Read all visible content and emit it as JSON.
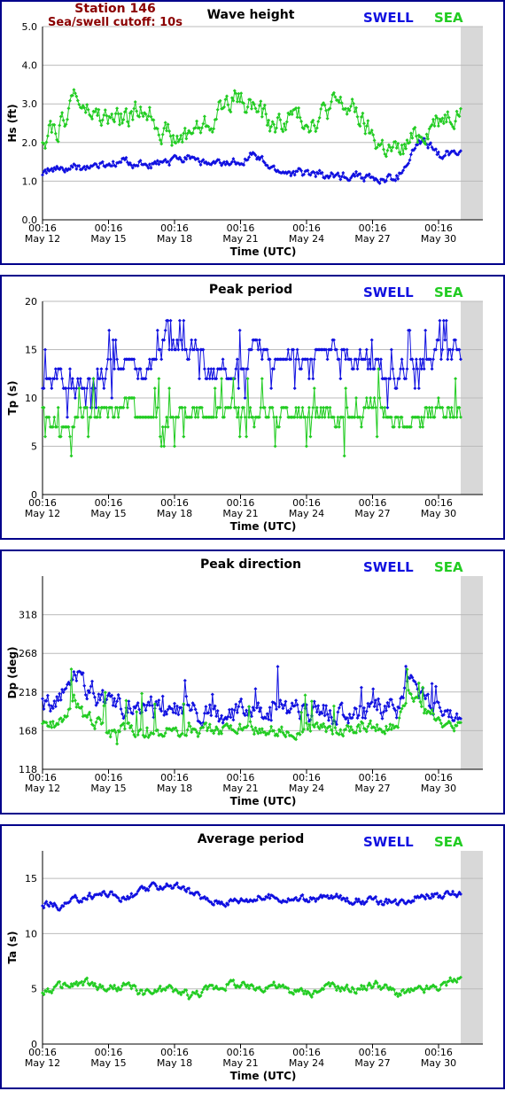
{
  "header": {
    "station": "Station 146",
    "cutoff": "Sea/swell cutoff: 10s"
  },
  "colors": {
    "swell": "#1010e0",
    "sea": "#22cc22",
    "frame": "#00008b",
    "grid": "#bbbbbb",
    "shade": "#d8d8d8"
  },
  "chart_data": [
    {
      "type": "scatter",
      "title": "Wave height",
      "ylabel": "Hs (ft)",
      "xlabel": "Time (UTC)",
      "ylim": [
        0,
        5
      ],
      "yticks": [
        "0.0",
        "1.0",
        "2.0",
        "3.0",
        "4.0",
        "5.0"
      ],
      "xlim": [
        0,
        20
      ],
      "xticks": [
        {
          "time": "00:16",
          "date": "May 12"
        },
        {
          "time": "00:16",
          "date": "May 15"
        },
        {
          "time": "00:16",
          "date": "May 18"
        },
        {
          "time": "00:16",
          "date": "May 21"
        },
        {
          "time": "00:16",
          "date": "May 24"
        },
        {
          "time": "00:16",
          "date": "May 27"
        },
        {
          "time": "00:16",
          "date": "May 30"
        }
      ],
      "grid": true,
      "legend": [
        "SWELL",
        "SEA"
      ],
      "series": [
        {
          "name": "SWELL",
          "color": "#1010e0",
          "x": [
            0,
            1,
            2,
            3,
            4,
            5,
            6,
            7,
            8,
            9,
            10,
            11,
            12,
            13,
            14,
            15,
            16,
            17,
            18,
            18.5,
            19,
            20
          ],
          "y": [
            1.25,
            1.3,
            1.35,
            1.4,
            1.5,
            1.4,
            1.45,
            1.7,
            1.4,
            1.45,
            1.7,
            1.3,
            1.2,
            1.2,
            1.1,
            1.2,
            1.0,
            1.1,
            2.0,
            1.9,
            1.7,
            1.8
          ]
        },
        {
          "name": "SEA",
          "color": "#22cc22",
          "x": [
            0,
            1,
            1.5,
            2,
            3,
            4,
            5,
            6,
            6.5,
            7,
            8,
            9,
            10,
            11,
            12,
            13,
            14,
            15,
            15.5,
            16,
            17,
            18,
            19,
            20
          ],
          "y": [
            2.2,
            2.5,
            3.3,
            2.8,
            2.6,
            2.6,
            2.9,
            2.2,
            2.0,
            2.3,
            2.5,
            3.2,
            3.0,
            2.4,
            2.7,
            2.6,
            3.0,
            2.8,
            2.3,
            2.0,
            1.7,
            2.2,
            2.7,
            2.9
          ]
        }
      ]
    },
    {
      "type": "scatter",
      "title": "Peak period",
      "ylabel": "Tp (s)",
      "xlabel": "Time (UTC)",
      "ylim": [
        0,
        20
      ],
      "yticks": [
        "0",
        "5",
        "10",
        "15",
        "20"
      ],
      "xlim": [
        0,
        20
      ],
      "xticks": [
        {
          "time": "00:16",
          "date": "May 12"
        },
        {
          "time": "00:16",
          "date": "May 15"
        },
        {
          "time": "00:16",
          "date": "May 18"
        },
        {
          "time": "00:16",
          "date": "May 21"
        },
        {
          "time": "00:16",
          "date": "May 24"
        },
        {
          "time": "00:16",
          "date": "May 27"
        },
        {
          "time": "00:16",
          "date": "May 30"
        }
      ],
      "grid": true,
      "legend": [
        "SWELL",
        "SEA"
      ],
      "series": [
        {
          "name": "SWELL",
          "color": "#1010e0",
          "x": [
            0,
            1,
            2,
            3,
            4,
            5,
            6,
            7,
            8,
            9,
            10,
            11,
            12,
            13,
            14,
            15,
            16,
            17,
            18,
            19,
            20
          ],
          "y": [
            12,
            12,
            11,
            13,
            14,
            13,
            16.5,
            15,
            13,
            12,
            15,
            14,
            14,
            14,
            15,
            14,
            13,
            12,
            14,
            15,
            15
          ]
        },
        {
          "name": "SEA",
          "color": "#22cc22",
          "x": [
            0,
            1,
            2,
            3,
            4,
            5,
            6,
            7,
            8,
            9,
            10,
            11,
            12,
            13,
            14,
            15,
            16,
            17,
            18,
            19,
            20
          ],
          "y": [
            8.5,
            7,
            9,
            9,
            9,
            8,
            7.5,
            9,
            8,
            9,
            8.5,
            8,
            9,
            8.5,
            8,
            8.5,
            9,
            7,
            7.5,
            8.5,
            8.5
          ]
        }
      ]
    },
    {
      "type": "scatter",
      "title": "Peak direction",
      "ylabel": "Dp (deg)",
      "xlabel": "Time (UTC)",
      "ylim": [
        118,
        368
      ],
      "yticks": [
        "118",
        "168",
        "218",
        "268",
        "318"
      ],
      "xlim": [
        0,
        20
      ],
      "xticks": [
        {
          "time": "00:16",
          "date": "May 12"
        },
        {
          "time": "00:16",
          "date": "May 15"
        },
        {
          "time": "00:16",
          "date": "May 18"
        },
        {
          "time": "00:16",
          "date": "May 21"
        },
        {
          "time": "00:16",
          "date": "May 24"
        },
        {
          "time": "00:16",
          "date": "May 27"
        },
        {
          "time": "00:16",
          "date": "May 30"
        }
      ],
      "grid": true,
      "legend": [
        "SWELL",
        "SEA"
      ],
      "series": [
        {
          "name": "SWELL",
          "color": "#1010e0",
          "x": [
            0,
            1,
            1.5,
            2,
            3,
            4,
            5,
            6,
            7,
            8,
            9,
            10,
            11,
            12,
            13,
            14,
            15,
            16,
            17,
            17.5,
            18,
            19,
            20
          ],
          "y": [
            200,
            215,
            250,
            225,
            205,
            200,
            210,
            200,
            195,
            190,
            185,
            190,
            195,
            192,
            190,
            192,
            190,
            192,
            195,
            240,
            210,
            200,
            195
          ]
        },
        {
          "name": "SEA",
          "color": "#22cc22",
          "x": [
            0,
            1,
            1.5,
            2,
            3,
            4,
            5,
            6,
            7,
            8,
            9,
            10,
            11,
            12,
            13,
            14,
            15,
            16,
            17,
            17.5,
            18,
            19,
            20
          ],
          "y": [
            172,
            180,
            220,
            185,
            172,
            170,
            168,
            167,
            168,
            168,
            172,
            170,
            168,
            168,
            170,
            168,
            170,
            172,
            175,
            220,
            200,
            180,
            175
          ]
        }
      ]
    },
    {
      "type": "scatter",
      "title": "Average period",
      "ylabel": "Ta (s)",
      "xlabel": "Time (UTC)",
      "ylim": [
        0,
        17.5
      ],
      "yticks": [
        "0",
        "5",
        "10",
        "15"
      ],
      "xlim": [
        0,
        20
      ],
      "xticks": [
        {
          "time": "00:16",
          "date": "May 12"
        },
        {
          "time": "00:16",
          "date": "May 15"
        },
        {
          "time": "00:16",
          "date": "May 18"
        },
        {
          "time": "00:16",
          "date": "May 21"
        },
        {
          "time": "00:16",
          "date": "May 24"
        },
        {
          "time": "00:16",
          "date": "May 27"
        },
        {
          "time": "00:16",
          "date": "May 30"
        }
      ],
      "grid": true,
      "legend": [
        "SWELL",
        "SEA"
      ],
      "series": [
        {
          "name": "SWELL",
          "color": "#1010e0",
          "x": [
            0,
            1,
            2,
            3,
            4,
            5,
            6,
            7,
            8,
            9,
            10,
            11,
            12,
            13,
            14,
            15,
            16,
            17,
            18,
            19,
            20
          ],
          "y": [
            12.8,
            12.5,
            13.3,
            13.7,
            13.2,
            14.0,
            14.5,
            13.8,
            12.9,
            13.0,
            13.2,
            13.3,
            13.1,
            13.2,
            13.3,
            13.0,
            12.9,
            12.8,
            13.6,
            13.4,
            13.6
          ]
        },
        {
          "name": "SEA",
          "color": "#22cc22",
          "x": [
            0,
            1,
            2,
            3,
            4,
            5,
            6,
            7,
            8,
            9,
            10,
            11,
            12,
            13,
            14,
            15,
            16,
            17,
            18,
            19,
            20
          ],
          "y": [
            4.8,
            5.2,
            5.5,
            5.0,
            5.2,
            4.6,
            5.0,
            4.4,
            5.0,
            5.6,
            5.0,
            5.5,
            4.6,
            4.8,
            5.2,
            5.0,
            5.5,
            4.6,
            4.8,
            5.2,
            6.0
          ]
        }
      ]
    }
  ]
}
